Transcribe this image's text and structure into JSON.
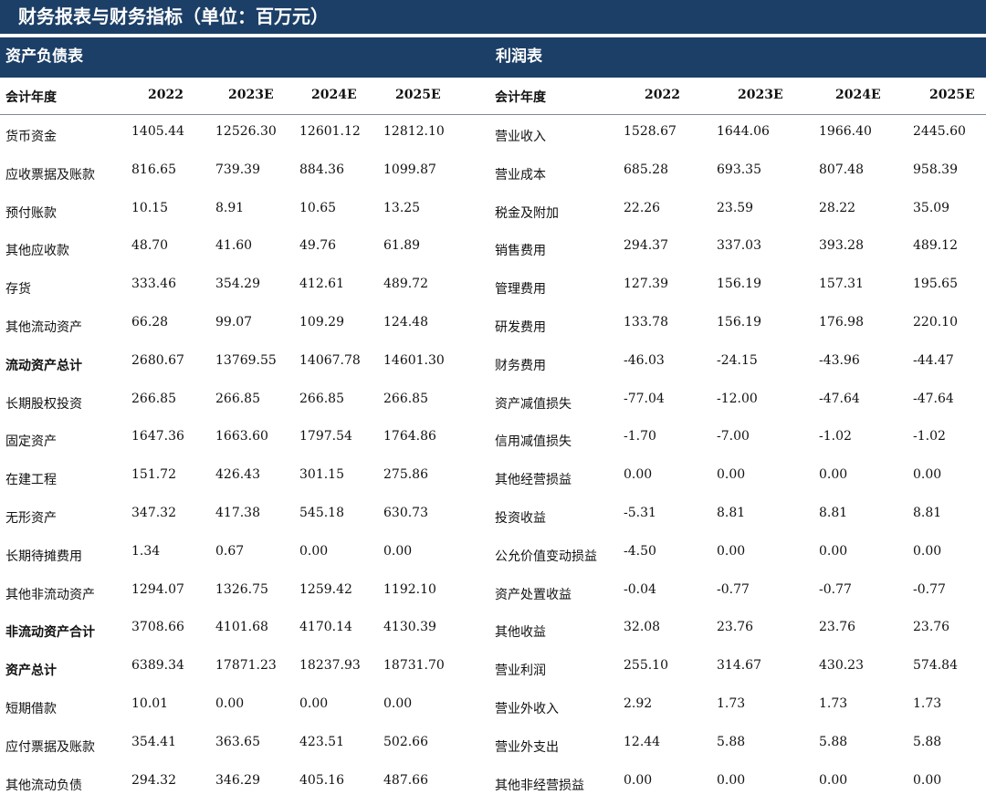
{
  "title": "财务报表与财务指标（单位：百万元）",
  "balance_sheet": {
    "section_title": "资产负债表",
    "header": [
      "会计年度",
      "2022",
      "2023E",
      "2024E",
      "2025E"
    ],
    "rows": [
      [
        "货币资金",
        "1405.44",
        "12526.30",
        "12601.12",
        "12812.10"
      ],
      [
        "应收票据及账款",
        "816.65",
        "739.39",
        "884.36",
        "1099.87"
      ],
      [
        "预付账款",
        "10.15",
        "8.91",
        "10.65",
        "13.25"
      ],
      [
        "其他应收款",
        "48.70",
        "41.60",
        "49.76",
        "61.89"
      ],
      [
        "存货",
        "333.46",
        "354.29",
        "412.61",
        "489.72"
      ],
      [
        "其他流动资产",
        "66.28",
        "99.07",
        "109.29",
        "124.48"
      ],
      [
        "流动资产总计",
        "2680.67",
        "13769.55",
        "14067.78",
        "14601.30"
      ],
      [
        "长期股权投资",
        "266.85",
        "266.85",
        "266.85",
        "266.85"
      ],
      [
        "固定资产",
        "1647.36",
        "1663.60",
        "1797.54",
        "1764.86"
      ],
      [
        "在建工程",
        "151.72",
        "426.43",
        "301.15",
        "275.86"
      ],
      [
        "无形资产",
        "347.32",
        "417.38",
        "545.18",
        "630.73"
      ],
      [
        "长期待摊费用",
        "1.34",
        "0.67",
        "0.00",
        "0.00"
      ],
      [
        "其他非流动资产",
        "1294.07",
        "1326.75",
        "1259.42",
        "1192.10"
      ],
      [
        "非流动资产合计",
        "3708.66",
        "4101.68",
        "4170.14",
        "4130.39"
      ],
      [
        "资产总计",
        "6389.34",
        "17871.23",
        "18237.93",
        "18731.70"
      ],
      [
        "短期借款",
        "10.01",
        "0.00",
        "0.00",
        "0.00"
      ],
      [
        "应付票据及账款",
        "354.41",
        "363.65",
        "423.51",
        "502.66"
      ],
      [
        "其他流动负债",
        "294.32",
        "346.29",
        "405.16",
        "487.66"
      ]
    ],
    "bold_rows": [
      6,
      13,
      14
    ]
  },
  "income_statement": {
    "section_title": "利润表",
    "header": [
      "会计年度",
      "2022",
      "2023E",
      "2024E",
      "2025E"
    ],
    "rows": [
      [
        "营业收入",
        "1528.67",
        "1644.06",
        "1966.40",
        "2445.60"
      ],
      [
        "营业成本",
        "685.28",
        "693.35",
        "807.48",
        "958.39"
      ],
      [
        "税金及附加",
        "22.26",
        "23.59",
        "28.22",
        "35.09"
      ],
      [
        "销售费用",
        "294.37",
        "337.03",
        "393.28",
        "489.12"
      ],
      [
        "管理费用",
        "127.39",
        "156.19",
        "157.31",
        "195.65"
      ],
      [
        "研发费用",
        "133.78",
        "156.19",
        "176.98",
        "220.10"
      ],
      [
        "财务费用",
        "-46.03",
        "-24.15",
        "-43.96",
        "-44.47"
      ],
      [
        "资产减值损失",
        "-77.04",
        "-12.00",
        "-47.64",
        "-47.64"
      ],
      [
        "信用减值损失",
        "-1.70",
        "-7.00",
        "-1.02",
        "-1.02"
      ],
      [
        "其他经营损益",
        "0.00",
        "0.00",
        "0.00",
        "0.00"
      ],
      [
        "投资收益",
        "-5.31",
        "8.81",
        "8.81",
        "8.81"
      ],
      [
        "公允价值变动损益",
        "-4.50",
        "0.00",
        "0.00",
        "0.00"
      ],
      [
        "资产处置收益",
        "-0.04",
        "-0.77",
        "-0.77",
        "-0.77"
      ],
      [
        "其他收益",
        "32.08",
        "23.76",
        "23.76",
        "23.76"
      ],
      [
        "营业利润",
        "255.10",
        "314.67",
        "430.23",
        "574.84"
      ],
      [
        "营业外收入",
        "2.92",
        "1.73",
        "1.73",
        "1.73"
      ],
      [
        "营业外支出",
        "12.44",
        "5.88",
        "5.88",
        "5.88"
      ],
      [
        "其他非经营损益",
        "0.00",
        "0.00",
        "0.00",
        "0.00"
      ]
    ]
  },
  "colors": {
    "header_bg": "#1c3f67",
    "header_text": "#ffffff",
    "body_text": "#111111"
  }
}
